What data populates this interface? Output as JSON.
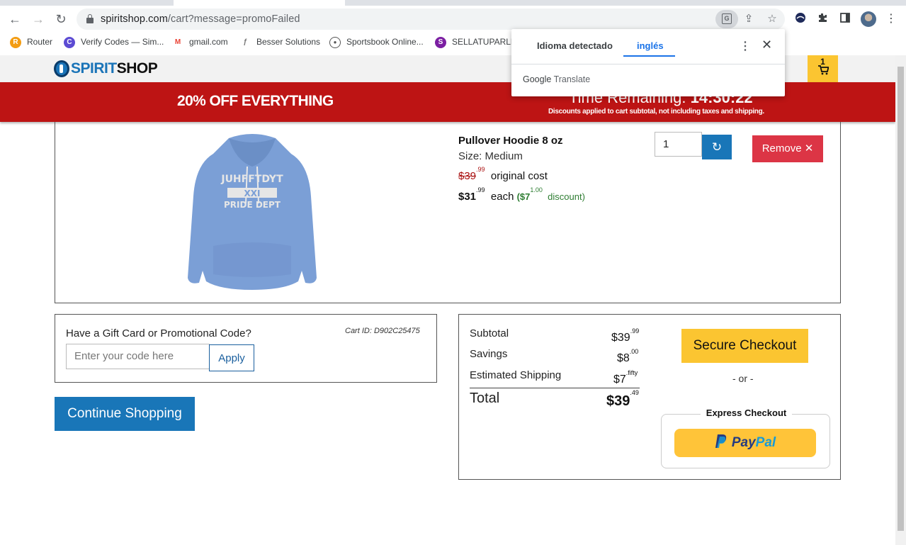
{
  "browser": {
    "url_domain": "spiritshop.com",
    "url_path": "/cart?message=promoFailed",
    "back_glyph": "←",
    "forward_glyph": "→",
    "reload_glyph": "↻",
    "share_glyph": "⇪",
    "star_glyph": "☆",
    "extensions_glyph": "✦",
    "sidepanel_glyph": "▣",
    "menu_glyph": "⋮",
    "translate_glyph": "G"
  },
  "bookmarks": [
    {
      "label": "Router",
      "icon": "router-icon",
      "color": "#f39c12",
      "glyph": "R"
    },
    {
      "label": "Verify Codes — Sim...",
      "icon": "verify-codes-icon",
      "color": "#5c4bd3",
      "glyph": "C"
    },
    {
      "label": "gmail.com",
      "icon": "gmail-icon",
      "color": "#ea4335",
      "glyph": "M"
    },
    {
      "label": "Besser Solutions",
      "icon": "besser-icon",
      "color": "#777777",
      "glyph": "ƒ"
    },
    {
      "label": "Sportsbook Online...",
      "icon": "globe-icon",
      "color": "#555555",
      "glyph": "●"
    },
    {
      "label": "SELLATUPARLEY",
      "icon": "sellatuparley-icon",
      "color": "#7b1fa2",
      "glyph": "S"
    }
  ],
  "site": {
    "logo_spirit": "SPIRIT",
    "logo_shop": "SHOP",
    "cart_count": "1",
    "cart_glyph": "🛒"
  },
  "banner": {
    "headline": "20% OFF EVERYTHING",
    "timer_label": "Time Remaining:",
    "timer_value": "14:30:22",
    "note": "Discounts applied to cart subtotal, not including taxes and shipping."
  },
  "item": {
    "name": "Pullover Hoodie 8 oz",
    "size": "Size: Medium",
    "original_price": "$39",
    "original_cents": ".99",
    "original_label": "original cost",
    "sale_price": "$31",
    "sale_cents": ".99",
    "each_label": "each",
    "discount_open": "($7",
    "discount_cents": "1.00",
    "discount_label": "discount)",
    "quantity": "1",
    "refresh_glyph": "↻",
    "remove_label": "Remove",
    "remove_glyph": "✕",
    "hoodie_text_1": "JUHFFTDYT",
    "hoodie_text_2": "XXI",
    "hoodie_text_3": "PRIDE DEPT"
  },
  "promo": {
    "title": "Have a Gift Card or Promotional Code?",
    "cart_id": "Cart ID: D902C25475",
    "placeholder": "Enter your code here",
    "apply_label": "Apply"
  },
  "continue_label": "Continue Shopping",
  "summary": {
    "subtotal_label": "Subtotal",
    "subtotal_value": "$39",
    "subtotal_cents": ".99",
    "savings_label": "Savings",
    "savings_value": "$8",
    "savings_cents": ".00",
    "shipping_label": "Estimated Shipping",
    "shipping_value": "$7",
    "shipping_cents": ".fifty",
    "total_label": "Total",
    "total_value": "$39",
    "total_cents": ".49",
    "checkout_label": "Secure Checkout",
    "or_label": "- or -",
    "express_label": "Express Checkout",
    "paypal_pay": "Pay",
    "paypal_pal": "Pal"
  },
  "translate_popup": {
    "tab_detected": "Idioma detectado",
    "tab_language": "inglés",
    "brand_google": "Google",
    "brand_translate": "Translate",
    "menu_glyph": "⋮",
    "close_glyph": "✕"
  },
  "colors": {
    "banner_red": "#bd1414",
    "accent_blue": "#1976b8",
    "cart_yellow": "#fbc531",
    "remove_red": "#dc3545"
  }
}
